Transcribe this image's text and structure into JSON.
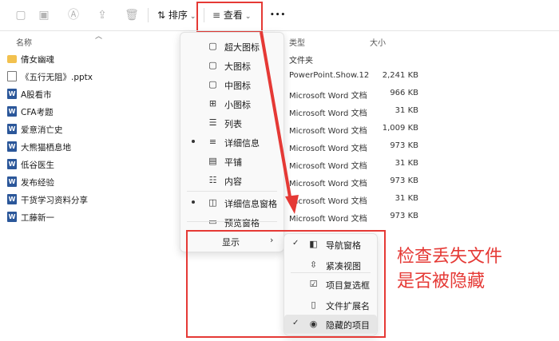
{
  "toolbar": {
    "sort_label": "排序",
    "view_label": "查看",
    "more_label": "•••"
  },
  "columns": {
    "name": "名称",
    "type": "类型",
    "size": "大小"
  },
  "files": [
    {
      "name": "倩女幽魂",
      "kind": "folder",
      "type": "文件夹",
      "size": ""
    },
    {
      "name": "《五行无阻》.pptx",
      "kind": "doc",
      "type": "PowerPoint.Show.12",
      "size": "2,241 KB"
    },
    {
      "name": "A股看市",
      "kind": "word",
      "type": "Microsoft Word 文档",
      "size": "966 KB"
    },
    {
      "name": "CFA考题",
      "kind": "word",
      "type": "Microsoft Word 文档",
      "size": "31 KB"
    },
    {
      "name": "爱意消亡史",
      "kind": "word",
      "type": "Microsoft Word 文档",
      "size": "1,009 KB"
    },
    {
      "name": "大熊猫栖息地",
      "kind": "word",
      "type": "Microsoft Word 文档",
      "size": "973 KB"
    },
    {
      "name": "低谷医生",
      "kind": "word",
      "type": "Microsoft Word 文档",
      "size": "31 KB"
    },
    {
      "name": "发布经验",
      "kind": "word",
      "type": "Microsoft Word 文档",
      "size": "973 KB"
    },
    {
      "name": "干货学习资料分享",
      "kind": "word",
      "type": "Microsoft Word 文档",
      "size": "31 KB"
    },
    {
      "name": "工藤新一",
      "kind": "word",
      "type": "Microsoft Word 文档",
      "size": "973 KB"
    }
  ],
  "view_menu": {
    "items": [
      {
        "label": "超大图标",
        "icon": "square-icon",
        "selected": false
      },
      {
        "label": "大图标",
        "icon": "square-icon",
        "selected": false
      },
      {
        "label": "中图标",
        "icon": "square-icon",
        "selected": false
      },
      {
        "label": "小图标",
        "icon": "grid-icon",
        "selected": false
      },
      {
        "label": "列表",
        "icon": "list-icon",
        "selected": false
      },
      {
        "label": "详细信息",
        "icon": "details-icon",
        "selected": true
      },
      {
        "label": "平铺",
        "icon": "tiles-icon",
        "selected": false
      },
      {
        "label": "内容",
        "icon": "content-icon",
        "selected": false
      },
      {
        "label": "详细信息窗格",
        "icon": "details-pane-icon",
        "selected": true
      },
      {
        "label": "预览窗格",
        "icon": "preview-pane-icon",
        "selected": false
      }
    ],
    "show_label": "显示"
  },
  "show_menu": {
    "items": [
      {
        "label": "导航窗格",
        "icon": "nav-pane-icon",
        "checked": true
      },
      {
        "label": "紧凑视图",
        "icon": "compact-icon",
        "checked": false
      },
      {
        "label": "项目复选框",
        "icon": "checkbox-icon",
        "checked": false
      },
      {
        "label": "文件扩展名",
        "icon": "file-ext-icon",
        "checked": false
      },
      {
        "label": "隐藏的项目",
        "icon": "eye-icon",
        "checked": true
      }
    ]
  },
  "annotation": {
    "line1": "检查丢失文件",
    "line2": "是否被隐藏"
  },
  "colors": {
    "highlight": "#e53935",
    "word_blue": "#2b579a",
    "folder": "#f2c14e"
  }
}
